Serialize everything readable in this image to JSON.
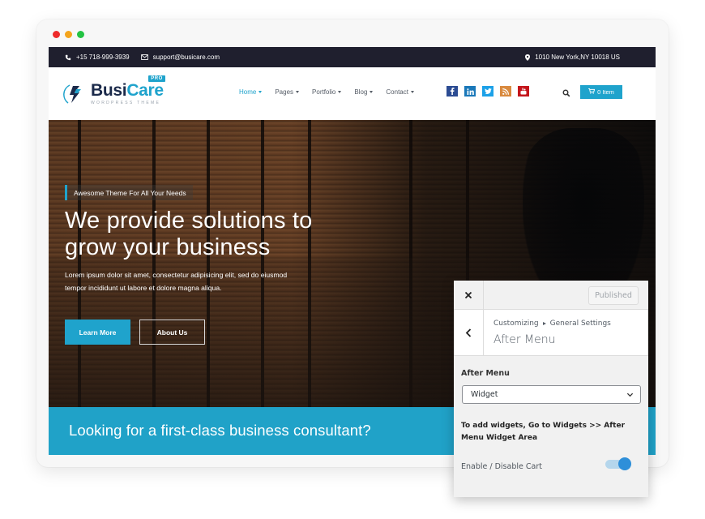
{
  "window": {
    "controls": [
      "close",
      "minimize",
      "maximize"
    ]
  },
  "topbar": {
    "phone_icon": "phone-icon",
    "phone": "+15 718-999-3939",
    "email_icon": "envelope-icon",
    "email": "support@busicare.com",
    "address_icon": "map-marker-icon",
    "address": "1010 New York,NY 10018 US"
  },
  "header": {
    "logo": {
      "name_part1": "Busi",
      "name_part2": "Care",
      "badge": "PRO",
      "tagline": "WORDPRESS THEME"
    },
    "nav": [
      {
        "label": "Home",
        "active": true
      },
      {
        "label": "Pages",
        "active": false
      },
      {
        "label": "Portfolio",
        "active": false
      },
      {
        "label": "Blog",
        "active": false
      },
      {
        "label": "Contact",
        "active": false
      }
    ],
    "socials": [
      {
        "name": "facebook",
        "glyph": "f",
        "color": "#2c4c93"
      },
      {
        "name": "linkedin",
        "glyph": "in",
        "color": "#1a78b9"
      },
      {
        "name": "twitter",
        "glyph": "t",
        "color": "#1da1e8"
      },
      {
        "name": "rss",
        "glyph": "rss",
        "color": "#d98a3f"
      },
      {
        "name": "youtube",
        "glyph": "yt",
        "color": "#c4161c"
      }
    ],
    "search_icon": "search-icon",
    "cart_label": "0 Item"
  },
  "hero": {
    "tagline": "Awesome Theme For All Your Needs",
    "title_line1": "We provide solutions to",
    "title_line2": "grow your business",
    "description_line1": "Lorem ipsum dolor sit amet, consectetur adipisicing elit, sed do eiusmod",
    "description_line2": "tempor incididunt ut labore et dolore magna aliqua.",
    "primary_button": "Learn More",
    "secondary_button": "About Us"
  },
  "cta": {
    "text": "Looking for a first-class business consultant?"
  },
  "customizer": {
    "close_label": "×",
    "publish_label": "Published",
    "breadcrumb_root": "Customizing",
    "breadcrumb_section": "General Settings",
    "section_title": "After Menu",
    "field_label": "After Menu",
    "select_value": "Widget",
    "note": "To add widgets, Go to Widgets >> After Menu Widget Area",
    "toggle_label": "Enable / Disable Cart",
    "toggle_on": true
  },
  "colors": {
    "accent": "#1fa3cc",
    "topbar_bg": "#1f1f2e",
    "brand_dark": "#1b2a4a",
    "toggle_knob": "#2e8fd9"
  }
}
